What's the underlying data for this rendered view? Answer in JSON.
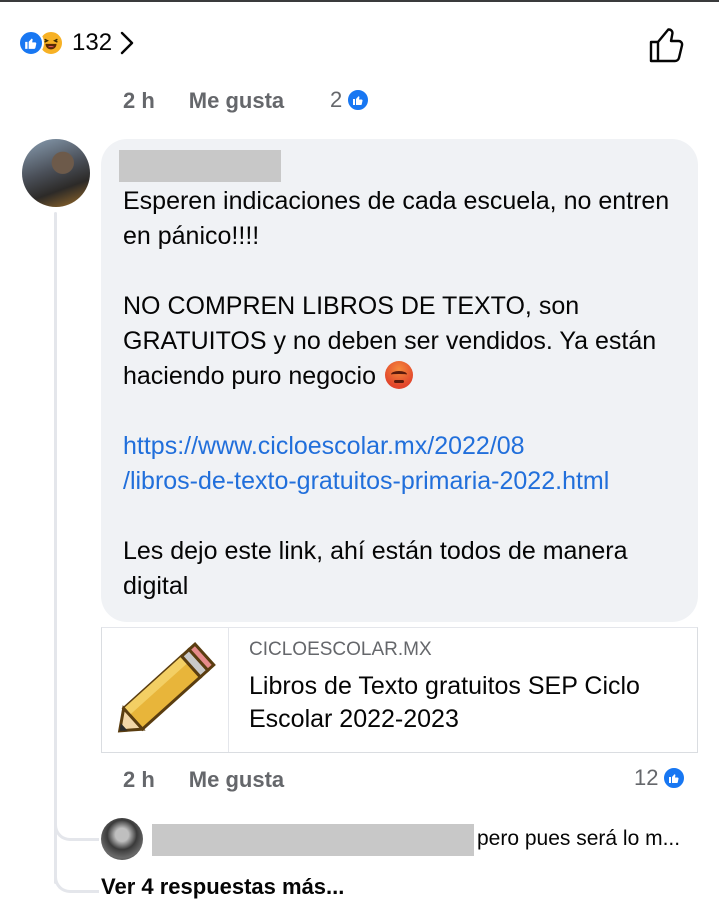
{
  "post_reactions": {
    "count": "132",
    "types": [
      "like-icon",
      "haha-icon"
    ]
  },
  "first_meta": {
    "time": "2 h",
    "like_label": "Me gusta",
    "like_count": "2"
  },
  "comment": {
    "paragraph_1": "Esperen indicaciones de cada escuela, no entren en pánico!!!!",
    "paragraph_2": "NO COMPREN LIBROS DE TEXTO, son GRATUITOS y no deben ser vendidos. Ya están haciendo puro negocio",
    "link_line_1": "https://www.cicloescolar.mx/2022/08",
    "link_line_2": "/libros-de-texto-gratuitos-primaria-2022.html",
    "paragraph_3": "Les dejo este link, ahí están todos de manera digital",
    "emoji": "angry-face-emoji"
  },
  "preview": {
    "domain": "CICLOESCOLAR.MX",
    "title": "Libros de Texto gratuitos SEP Ciclo Escolar 2022-2023",
    "thumbnail_icon": "pencil-icon"
  },
  "comment_meta": {
    "time": "2 h",
    "like_label": "Me gusta",
    "like_count": "12"
  },
  "reply": {
    "text": "pero pues será lo m..."
  },
  "view_more": {
    "label": "Ver 4 respuestas más..."
  },
  "colors": {
    "like_blue": "#1877f2",
    "link_blue": "#216fdb",
    "bubble_bg": "#f0f2f5",
    "meta_gray": "#65676b"
  }
}
